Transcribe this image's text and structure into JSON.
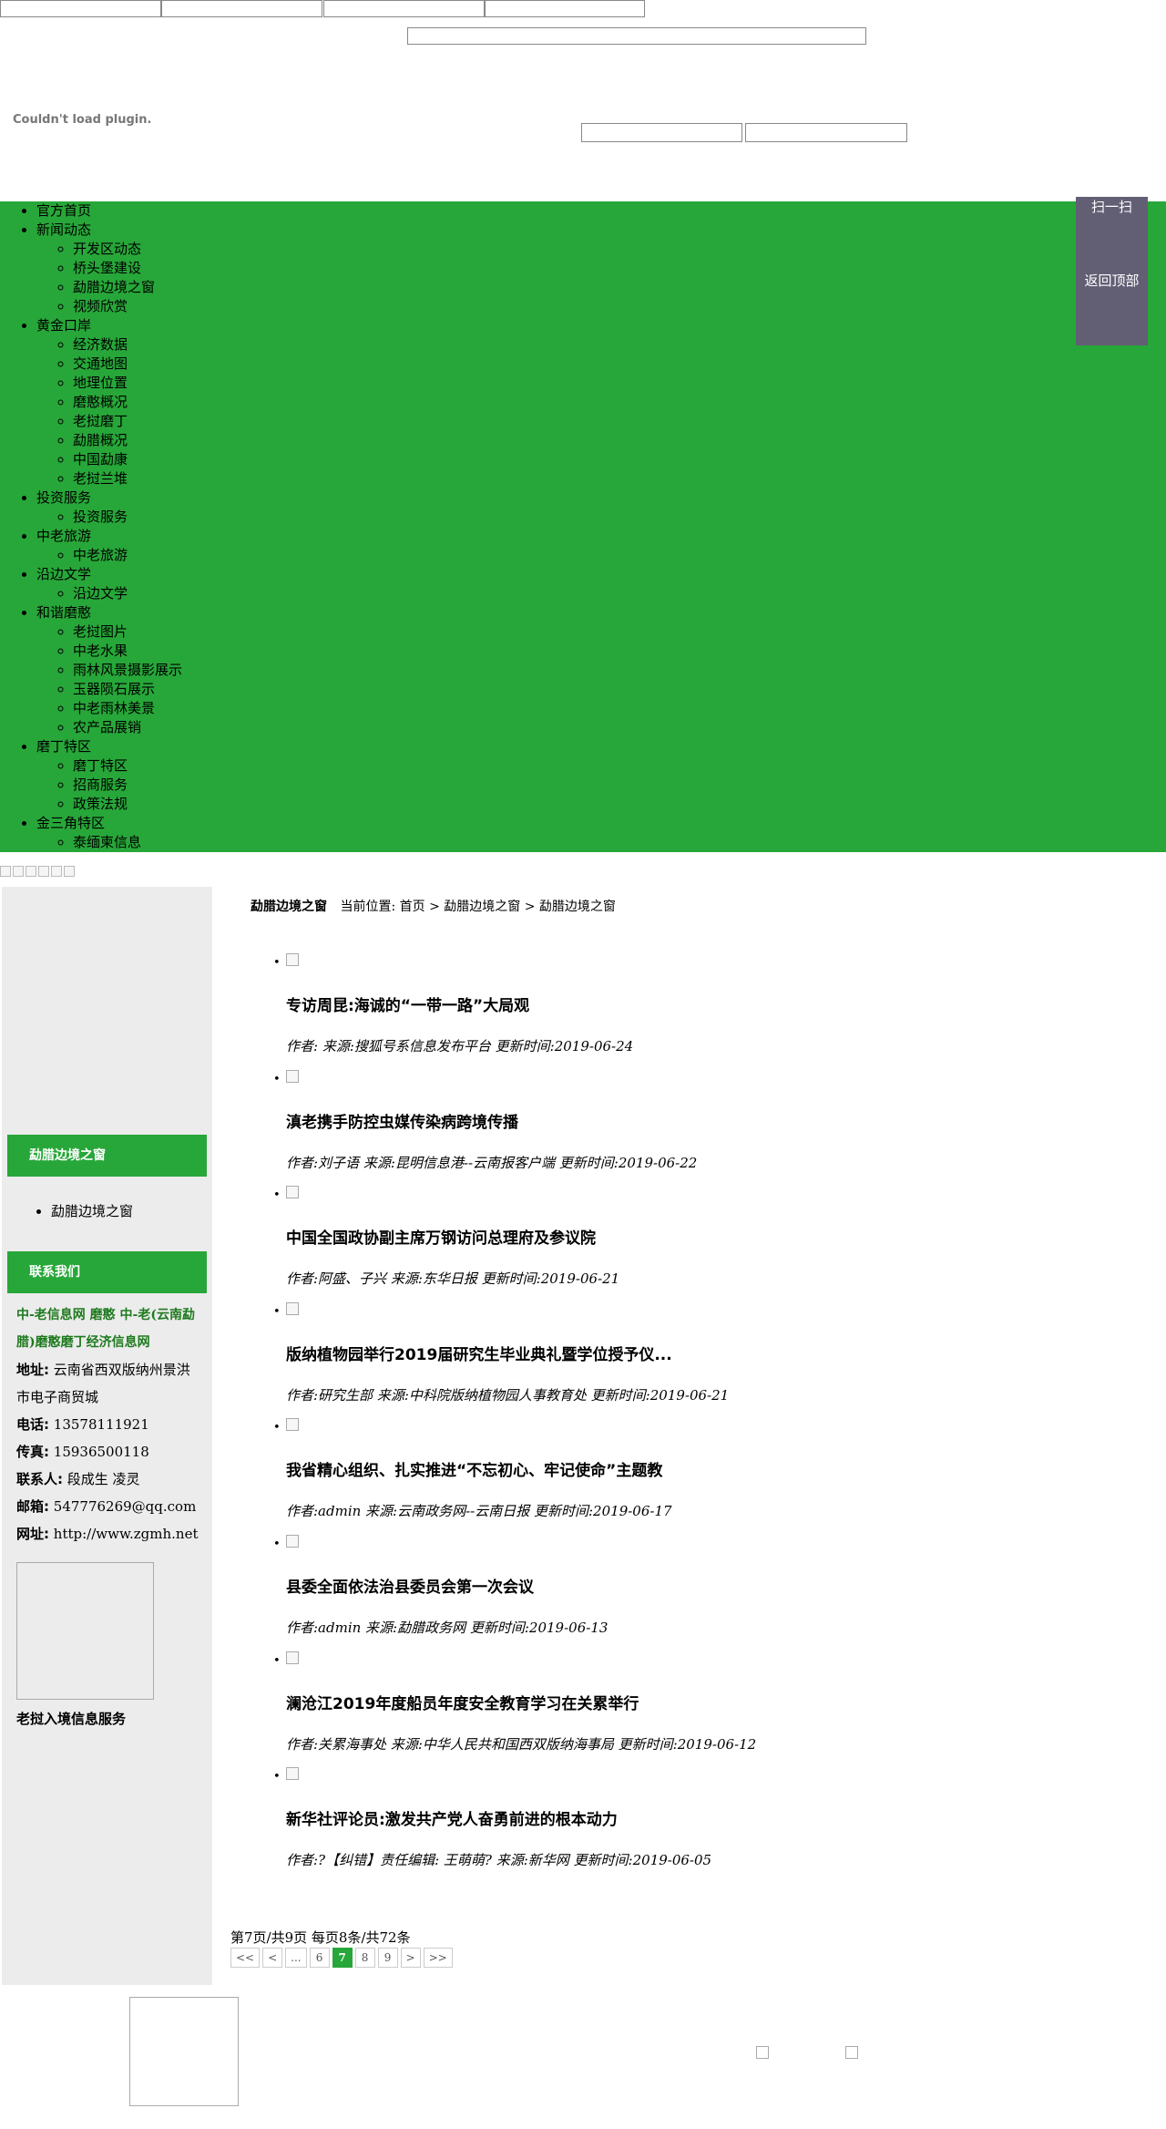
{
  "plugin_message": "Couldn't load plugin.",
  "nav": [
    {
      "label": "官方首页",
      "children": []
    },
    {
      "label": "新闻动态",
      "children": [
        "开发区动态",
        "桥头堡建设",
        "勐腊边境之窗",
        "视频欣赏"
      ]
    },
    {
      "label": "黄金口岸",
      "children": [
        "经济数据",
        "交通地图",
        "地理位置",
        "磨憨概况",
        "老挝磨丁",
        "勐腊概况",
        "中国勐康",
        "老挝兰堆"
      ]
    },
    {
      "label": "投资服务",
      "children": [
        "投资服务"
      ]
    },
    {
      "label": "中老旅游",
      "children": [
        "中老旅游"
      ]
    },
    {
      "label": "沿边文学",
      "children": [
        "沿边文学"
      ]
    },
    {
      "label": "和谐磨憨",
      "children": [
        "老挝图片",
        "中老水果",
        "雨林风景摄影展示",
        "玉器陨石展示",
        "中老雨林美景",
        "农产品展销"
      ]
    },
    {
      "label": "磨丁特区",
      "children": [
        "磨丁特区",
        "招商服务",
        "政策法规"
      ]
    },
    {
      "label": "金三角特区",
      "children": [
        "泰缅柬信息"
      ]
    }
  ],
  "float_panel": {
    "scan": "扫一扫",
    "back_top": "返回顶部"
  },
  "sidebar": {
    "section_title": "勐腊边境之窗",
    "section_items": [
      "勐腊边境之窗"
    ],
    "contact_title": "联系我们",
    "org_name": "中-老信息网 磨憨 中-老(云南勐腊)磨憨磨丁经济信息网",
    "contact": [
      {
        "label": "地址:",
        "value": "云南省西双版纳州景洪市电子商贸城"
      },
      {
        "label": "电话:",
        "value": "13578111921"
      },
      {
        "label": "传真:",
        "value": "15936500118"
      },
      {
        "label": "联系人:",
        "value": "段成生 凌灵"
      },
      {
        "label": "邮箱:",
        "value": "547776269@qq.com"
      },
      {
        "label": "网址:",
        "value": "http://www.zgmh.net"
      }
    ],
    "image_caption": "老挝入境信息服务"
  },
  "breadcrumb": {
    "section": "勐腊边境之窗",
    "prefix": "当前位置:",
    "home": "首页",
    "sep1": ">",
    "level1": "勐腊边境之窗",
    "sep2": ">",
    "level2": "勐腊边境之窗"
  },
  "news": [
    {
      "title": "专访周昆:海诚的“一带一路”大局观",
      "meta": "作者:  来源:搜狐号系信息发布平台  更新时间:2019-06-24"
    },
    {
      "title": "滇老携手防控虫媒传染病跨境传播",
      "meta": "作者:刘子语 来源:昆明信息港--云南报客户端  更新时间:2019-06-22"
    },
    {
      "title": "中国全国政协副主席万钢访问总理府及参议院",
      "meta": "作者:阿盛、子兴 来源:东华日报  更新时间:2019-06-21"
    },
    {
      "title": "版纳植物园举行2019届研究生毕业典礼暨学位授予仪...",
      "meta": "作者:研究生部  来源:中科院版纳植物园人事教育处  更新时间:2019-06-21"
    },
    {
      "title": "我省精心组织、扎实推进“不忘初心、牢记使命”主题教",
      "meta": "作者:admin 来源:云南政务网--云南日报  更新时间:2019-06-17"
    },
    {
      "title": "县委全面依法治县委员会第一次会议",
      "meta": "作者:admin 来源:勐腊政务网  更新时间:2019-06-13"
    },
    {
      "title": "澜沧江2019年度船员年度安全教育学习在关累举行",
      "meta": "作者:关累海事处 来源:中华人民共和国西双版纳海事局  更新时间:2019-06-12"
    },
    {
      "title": "新华社评论员:激发共产党人奋勇前进的根本动力",
      "meta": "作者:?【纠错】责任编辑: 王萌萌? 来源:新华网  更新时间:2019-06-05"
    }
  ],
  "pagination": {
    "info": "第7页/共9页 每页8条/共72条",
    "buttons": [
      "<<",
      "<",
      "...",
      "6",
      "7",
      "8",
      "9",
      ">",
      ">>"
    ],
    "current": "7"
  }
}
